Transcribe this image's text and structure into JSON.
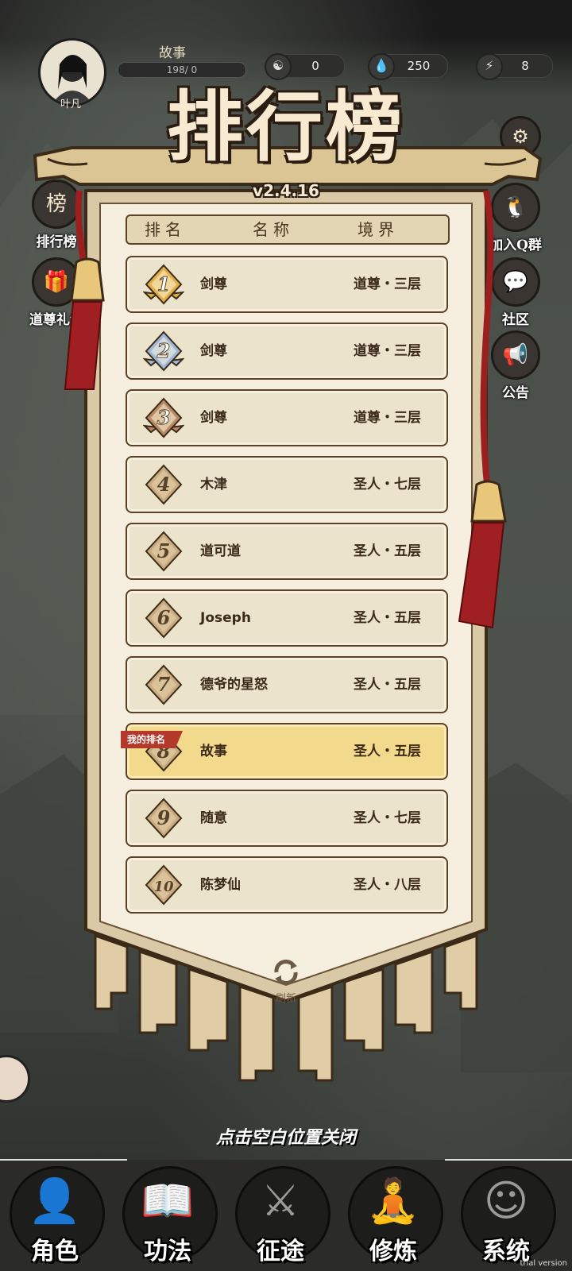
{
  "top_bar": {
    "avatar_name": "叶凡",
    "player_name": "故事",
    "exp_text": "198/   0",
    "resources": [
      {
        "icon": "yin-yang-icon",
        "glyph": "☯",
        "value": "0"
      },
      {
        "icon": "spirit-stone-icon",
        "glyph": "💧",
        "value": "250"
      },
      {
        "icon": "lightning-icon",
        "glyph": "⚡",
        "value": "8"
      }
    ]
  },
  "side_left": [
    {
      "label": "排行榜",
      "glyph": "榜"
    },
    {
      "label": "道尊礼包",
      "glyph": "🎁"
    }
  ],
  "side_right": [
    {
      "label": "加入Q群",
      "glyph": "🐧"
    },
    {
      "label": "社区",
      "glyph": "💬"
    },
    {
      "label": "公告",
      "glyph": "📢"
    }
  ],
  "leaderboard": {
    "title": "排行榜",
    "version": "v2.4.16",
    "headers": {
      "rank": "排名",
      "name": "名称",
      "realm": "境界"
    },
    "rows": [
      {
        "rank": "1",
        "name": "剑尊",
        "realm": "道尊・三层",
        "medal": "gold"
      },
      {
        "rank": "2",
        "name": "剑尊",
        "realm": "道尊・三层",
        "medal": "silver"
      },
      {
        "rank": "3",
        "name": "剑尊",
        "realm": "道尊・三层",
        "medal": "bronze"
      },
      {
        "rank": "4",
        "name": "木津",
        "realm": "圣人・七层",
        "medal": "plain"
      },
      {
        "rank": "5",
        "name": "道可道",
        "realm": "圣人・五层",
        "medal": "plain"
      },
      {
        "rank": "6",
        "name": "Joseph",
        "realm": "圣人・五层",
        "medal": "plain"
      },
      {
        "rank": "7",
        "name": "德爷的星怒",
        "realm": "圣人・五层",
        "medal": "plain"
      },
      {
        "rank": "8",
        "name": "故事",
        "realm": "圣人・五层",
        "medal": "plain",
        "is_me": true
      },
      {
        "rank": "9",
        "name": "随意",
        "realm": "圣人・七层",
        "medal": "plain"
      },
      {
        "rank": "10",
        "name": "陈梦仙",
        "realm": "圣人・八层",
        "medal": "plain"
      }
    ],
    "my_rank_tag": "我的排名",
    "refresh_label": "刷新"
  },
  "close_tip": "点击空白位置关闭",
  "bottom_nav": [
    {
      "label": "角色",
      "icon": "character-icon",
      "glyph": "👤"
    },
    {
      "label": "功法",
      "icon": "book-icon",
      "glyph": "📖"
    },
    {
      "label": "征途",
      "icon": "sword-icon",
      "glyph": "⚔"
    },
    {
      "label": "修炼",
      "icon": "meditation-icon",
      "glyph": "🧘"
    },
    {
      "label": "系统",
      "icon": "system-icon",
      "glyph": "☺"
    }
  ],
  "watermark": "trial version",
  "colors": {
    "parchment": "#ece3cc",
    "highlight_row": "#f3d98c",
    "border_brown": "#5b4125",
    "tag_red": "#b3392a",
    "gold": "#e2b04a",
    "silver": "#9fb8d8",
    "bronze": "#b98a63"
  }
}
